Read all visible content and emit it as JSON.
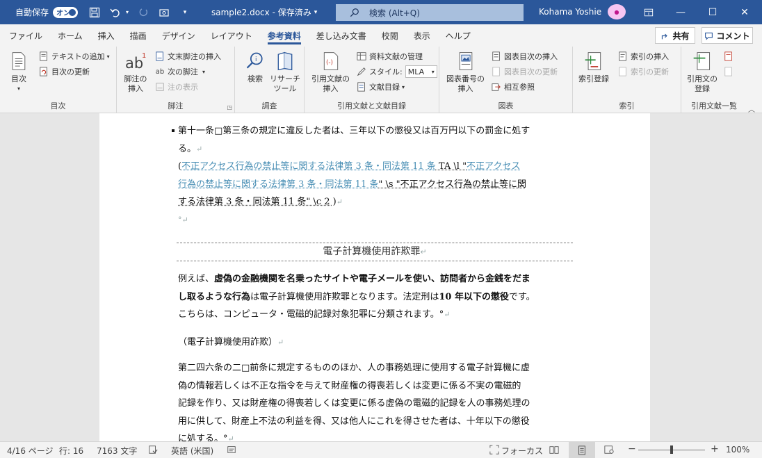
{
  "titlebar": {
    "autosave_label": "自動保存",
    "autosave_toggle": "オン",
    "doc_title": "sample2.docx - 保存済み",
    "search_placeholder": "検索 (Alt+Q)",
    "user_name": "Kohama Yoshie",
    "minimize": "—",
    "maximize": "☐",
    "close": "✕"
  },
  "tabs": [
    "ファイル",
    "ホーム",
    "挿入",
    "描画",
    "デザイン",
    "レイアウト",
    "参考資料",
    "差し込み文書",
    "校閲",
    "表示",
    "ヘルプ"
  ],
  "active_tab": "参考資料",
  "share_label": "共有",
  "comment_label": "コメント",
  "ribbon": {
    "toc": {
      "big": "目次",
      "add_text": "テキストの追加",
      "update_toc": "目次の更新",
      "group": "目次"
    },
    "footnotes": {
      "big1": "脚注の",
      "big2": "挿入",
      "endnote": "文末脚注の挿入",
      "next": "次の脚注",
      "show": "注の表示",
      "group": "脚注"
    },
    "research": {
      "search": "検索",
      "researcher1": "リサーチ",
      "researcher2": "ツール",
      "group": "調査"
    },
    "citations": {
      "insert1": "引用文献の",
      "insert2": "挿入",
      "manage": "資料文献の管理",
      "style_label": "スタイル:",
      "style_value": "MLA",
      "bibliography": "文献目録",
      "group": "引用文献と文献目録"
    },
    "captions": {
      "insert1": "図表番号の",
      "insert2": "挿入",
      "tof": "図表目次の挿入",
      "update_tof": "図表目次の更新",
      "crossref": "相互参照",
      "group": "図表"
    },
    "index": {
      "mark": "索引登録",
      "insert": "索引の挿入",
      "update": "索引の更新",
      "group": "索引"
    },
    "toa": {
      "mark1": "引用文の",
      "mark2": "登録",
      "group": "引用文献一覧"
    }
  },
  "doc": {
    "p1a": "第十一条□第三条の規定に違反した者は、三年以下の懲役又は百万円以下の罰金に処す",
    "p1b": "る。",
    "p2_open": "(",
    "p2_link1": "不正アクセス行為の禁止等に関する法律第 3 条・同法第 11 条",
    "p2_field1": " TA \\l \"",
    "p2_link2a": "不正アクセス",
    "p2_link2b": "行為の禁止等に関する法律第 3 条・同法第 11 条",
    "p2_field2a": "\" \\s \"不正アクセス行為の禁止等に関",
    "p2_field2b": "する法律第 3 条・同法第 11 条\" \\c 2 ",
    "p2_close": ")",
    "p3": "°",
    "heading": "電子計算機使用詐欺罪",
    "p4a_pre": "例えば、",
    "p4a_bold": "虚偽の金融機関を名乗ったサイトや電子メールを使い、訪問者から金銭をだま",
    "p4b_bold": "し取るような行為",
    "p4b_mid": "は電子計算機使用詐欺罪となります。法定刑は",
    "p4b_bold2": "10 年以下の懲役",
    "p4b_end": "です。",
    "p4c": "こちらは、コンピュータ・電磁的記録対象犯罪に分類されます。°",
    "p5": "（電子計算機使用詐欺）",
    "p6a": "第二四六条の二□前条に規定するもののほか、人の事務処理に使用する電子計算機に虚",
    "p6b": "偽の情報若しくは不正な指令を与えて財産権の得喪若しくは変更に係る不実の電磁的",
    "p6c": "記録を作り、又は財産権の得喪若しくは変更に係る虚偽の電磁的記録を人の事務処理の",
    "p6d": "用に供して、財産上不法の利益を得、又は他人にこれを得させた者は、十年以下の懲役",
    "p6e": "に処する。°"
  },
  "status": {
    "page": "4/16 ページ",
    "line": "行: 16",
    "words": "7163 文字",
    "language": "英語 (米国)",
    "focus": "フォーカス",
    "zoom": "100%",
    "zoom_level": 0.5
  }
}
